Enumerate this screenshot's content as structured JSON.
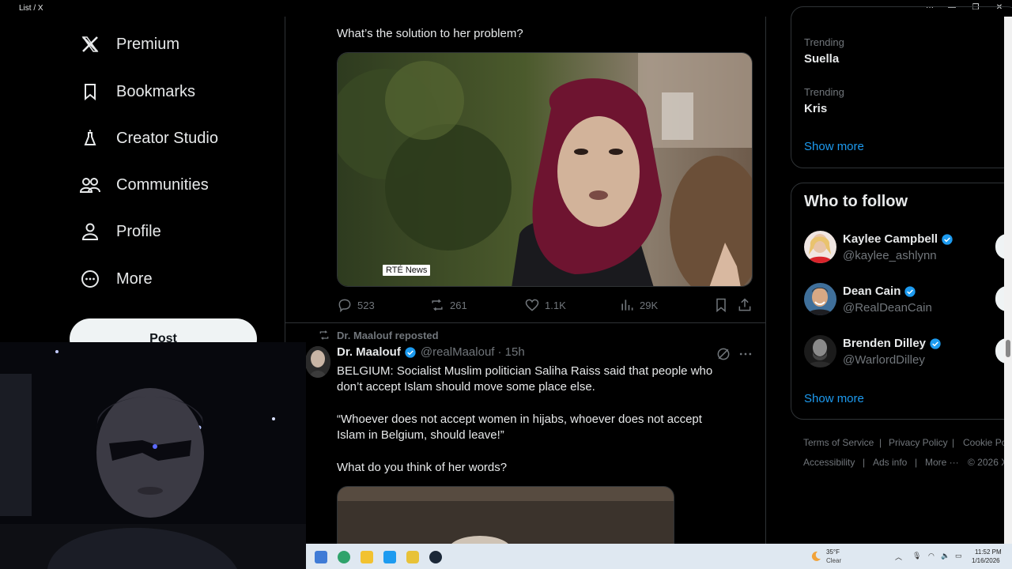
{
  "window": {
    "title": "List / X"
  },
  "nav": {
    "items": [
      {
        "label": "Premium",
        "icon": "x-logo-icon"
      },
      {
        "label": "Bookmarks",
        "icon": "bookmark-icon"
      },
      {
        "label": "Creator Studio",
        "icon": "flask-icon"
      },
      {
        "label": "Communities",
        "icon": "people-icon"
      },
      {
        "label": "Profile",
        "icon": "person-icon"
      },
      {
        "label": "More",
        "icon": "more-circle-icon"
      }
    ],
    "post_label": "Post"
  },
  "tweet1": {
    "text": "What’s the solution to her problem?",
    "media_badge": "RTÉ News",
    "stats": {
      "replies": "523",
      "reposts": "261",
      "likes": "1.1K",
      "views": "29K"
    }
  },
  "tweet2": {
    "repost_label": "Dr. Maalouf reposted",
    "author_name": "Dr. Maalouf",
    "handle": "@realMaalouf",
    "time": "· 15h",
    "para1": "BELGIUM: Socialist Muslim politician Saliha Raiss said that people who don’t accept Islam should move some place else.",
    "para2": "“Whoever does not accept women in hijabs, whoever does not accept Islam in Belgium, should leave!”",
    "para3": "What do you think of her words?"
  },
  "trending": {
    "items": [
      {
        "label": "Trending",
        "name": "Suella"
      },
      {
        "label": "Trending",
        "name": "Kris"
      }
    ],
    "show_more": "Show more"
  },
  "who_to_follow": {
    "title": "Who to follow",
    "users": [
      {
        "name": "Kaylee Campbell",
        "handle": "@kaylee_ashlynn"
      },
      {
        "name": "Dean Cain",
        "handle": "@RealDeanCain"
      },
      {
        "name": "Brenden Dilley",
        "handle": "@WarlordDilley"
      }
    ],
    "show_more": "Show more"
  },
  "footer": {
    "terms": "Terms of Service",
    "privacy": "Privacy Policy",
    "cookie": "Cookie Po",
    "accessibility": "Accessibility",
    "ads": "Ads info",
    "more": "More ···",
    "copyright": "© 2026 X"
  },
  "taskbar": {
    "temperature": "35°F",
    "condition": "Clear",
    "time": "11:52 PM",
    "date": "1/16/2026"
  },
  "colors": {
    "accent": "#1d9bf0",
    "background": "#000000",
    "muted": "#71767b",
    "text": "#e7e9ea"
  }
}
